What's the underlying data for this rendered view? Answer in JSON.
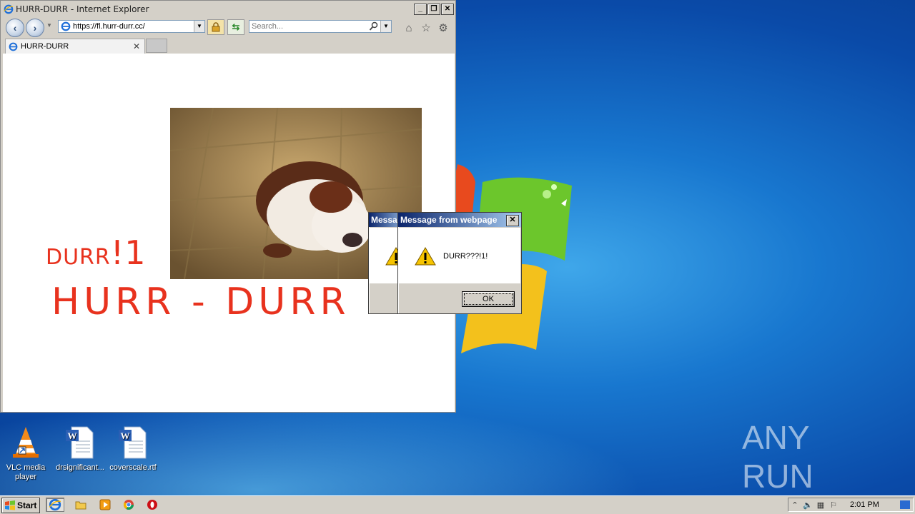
{
  "browser": {
    "window_title": "HURR-DURR - Internet Explorer",
    "address": "https://fl.hurr-durr.cc/",
    "search_placeholder": "Search...",
    "tab_label": "HURR-DURR"
  },
  "page": {
    "durr_small": "DURR",
    "durr_small_suffix": "!1",
    "hurr_big": "HURR - DURR"
  },
  "dialogs": {
    "back_title": "Message from webpage",
    "front_title": "Message from webpage",
    "message": "DURR???!1!",
    "ok_label": "OK"
  },
  "desktop": {
    "icons": [
      {
        "label": "VLC media player"
      },
      {
        "label": "drsignificant..."
      },
      {
        "label": "coverscale.rtf"
      }
    ],
    "watermark": "ANY RUN"
  },
  "taskbar": {
    "start_label": "Start",
    "clock": "2:01 PM"
  },
  "colors": {
    "page_text_red": "#e8321e",
    "dialog_title_blue": "#0a246a"
  }
}
